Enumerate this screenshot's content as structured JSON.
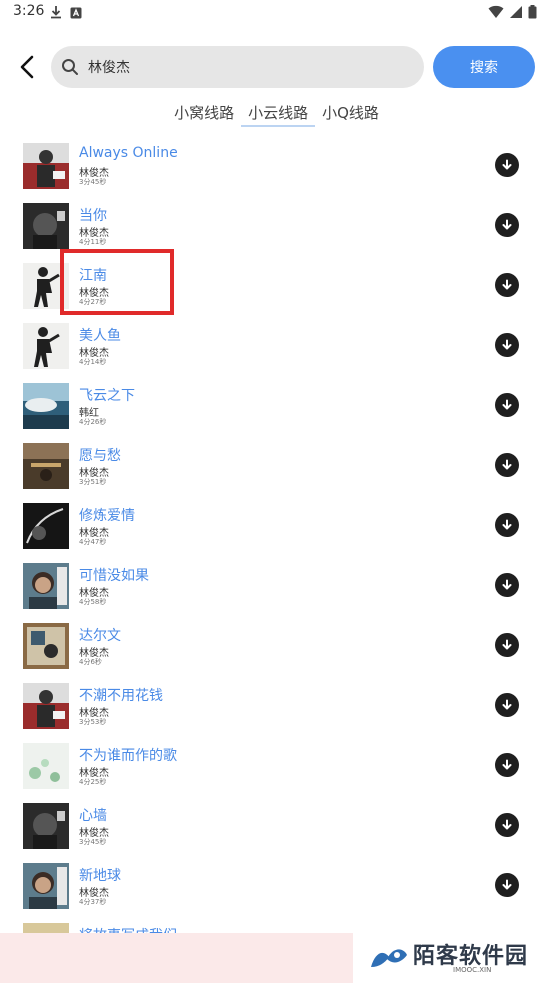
{
  "status_bar": {
    "time": "3:26"
  },
  "search": {
    "value": "林俊杰",
    "button_label": "搜索"
  },
  "tabs": [
    {
      "label": "小窝线路",
      "active": false
    },
    {
      "label": "小云线路",
      "active": true
    },
    {
      "label": "小Q线路",
      "active": false
    }
  ],
  "songs": [
    {
      "title": "Always Online",
      "artist": "林俊杰",
      "duration": "3分45秒"
    },
    {
      "title": "当你",
      "artist": "林俊杰",
      "duration": "4分11秒"
    },
    {
      "title": "江南",
      "artist": "林俊杰",
      "duration": "4分27秒"
    },
    {
      "title": "美人鱼",
      "artist": "林俊杰",
      "duration": "4分14秒"
    },
    {
      "title": "飞云之下",
      "artist": "韩红",
      "duration": "4分26秒"
    },
    {
      "title": "愿与愁",
      "artist": "林俊杰",
      "duration": "3分51秒"
    },
    {
      "title": "修炼爱情",
      "artist": "林俊杰",
      "duration": "4分47秒"
    },
    {
      "title": "可惜没如果",
      "artist": "林俊杰",
      "duration": "4分58秒"
    },
    {
      "title": "达尔文",
      "artist": "林俊杰",
      "duration": "4分6秒"
    },
    {
      "title": "不潮不用花钱",
      "artist": "林俊杰",
      "duration": "3分53秒"
    },
    {
      "title": "不为谁而作的歌",
      "artist": "林俊杰",
      "duration": "4分25秒"
    },
    {
      "title": "心墙",
      "artist": "林俊杰",
      "duration": "3分45秒"
    },
    {
      "title": "新地球",
      "artist": "林俊杰",
      "duration": "4分37秒"
    },
    {
      "title": "将故事写成我们",
      "artist": "",
      "duration": ""
    }
  ],
  "watermark": {
    "name": "陌客软件园",
    "sub": "IMOOC.XIN"
  },
  "colors": {
    "accent": "#4a90f0",
    "title_blue": "#4a8ae6",
    "highlight": "#e02a2a"
  }
}
